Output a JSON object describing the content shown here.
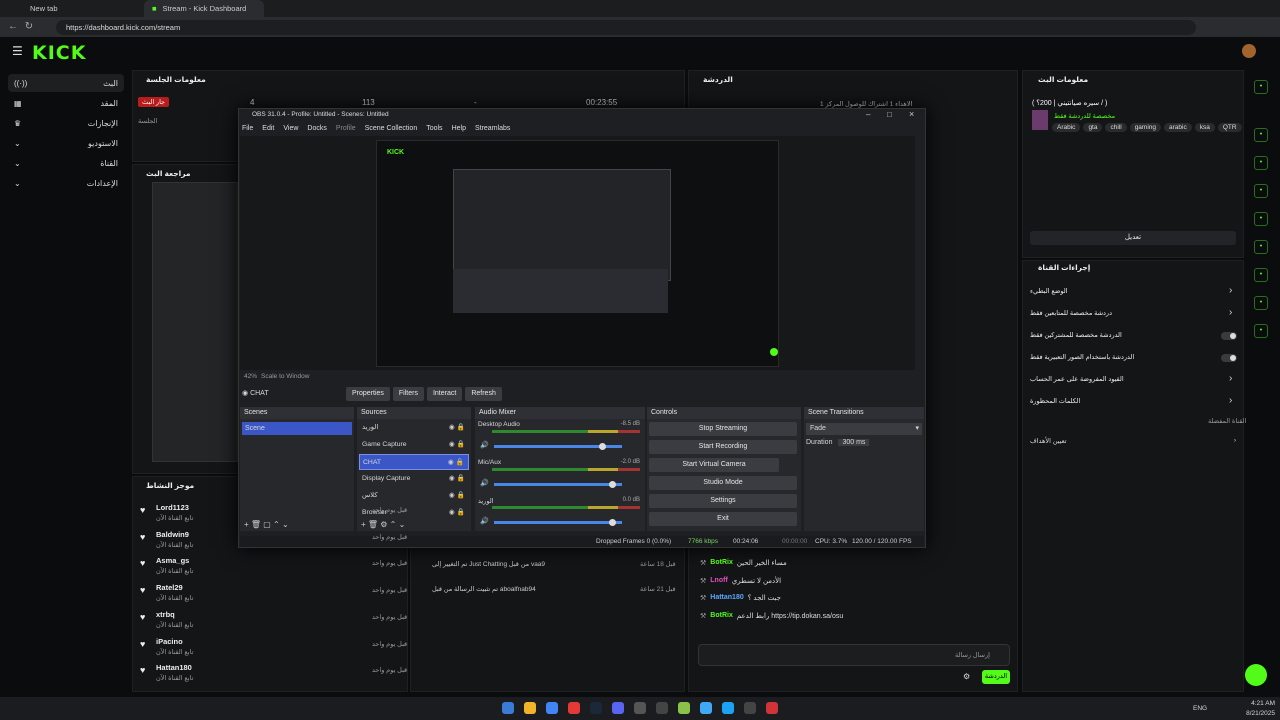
{
  "browser": {
    "tabs": [
      "New tab",
      "Stream - Kick Dashboard"
    ],
    "url": "https://dashboard.kick.com/stream"
  },
  "kick": {
    "logo": "KICK",
    "nav": [
      {
        "label": "البث",
        "icon": "broadcast-icon",
        "active": true
      },
      {
        "label": "المقد",
        "icon": "dashboard-icon"
      },
      {
        "label": "الإنجازات",
        "icon": "trophy-icon"
      },
      {
        "label": "الاستوديو",
        "icon": "studio-icon"
      },
      {
        "label": "القناة",
        "icon": "channel-icon"
      },
      {
        "label": "الإعدادات",
        "icon": "settings-icon"
      }
    ]
  },
  "session": {
    "title": "معلومات الجلسة",
    "live_badge": "جار البث",
    "session_label": "الجلسة",
    "stats": [
      "4",
      "113",
      "-",
      "00:23:55"
    ]
  },
  "preview": {
    "title": "مراجعة البث"
  },
  "activity": {
    "title": "موجز النشاط",
    "items": [
      {
        "name": "Lord1123",
        "sub": "تابع القناة الآن",
        "time": "قبل يوم واحد"
      },
      {
        "name": "Baldwin9",
        "sub": "تابع القناة الآن",
        "time": "قبل يوم واحد"
      },
      {
        "name": "Asma_gs",
        "sub": "تابع القناة الآن",
        "time": "قبل يوم واحد"
      },
      {
        "name": "Ratel29",
        "sub": "تابع القناة الآن",
        "time": "قبل يوم واحد"
      },
      {
        "name": "xtrbq",
        "sub": "تابع القناة الآن",
        "time": "قبل يوم واحد"
      },
      {
        "name": "iPacino",
        "sub": "تابع القناة الآن",
        "time": "قبل يوم واحد"
      },
      {
        "name": "Hattan180",
        "sub": "تابع القناة الآن",
        "time": "قبل يوم واحد"
      }
    ],
    "mid_items": [
      {
        "text": "تم التغيير إلى Just Chatting من قبل vaa9",
        "time": "قبل 18 ساعة"
      },
      {
        "text": "تم تثبيت الرسالة من قبل aboalfnab94",
        "time": "قبل 21 ساعة"
      }
    ]
  },
  "chat": {
    "title": "الدردشة",
    "pinned": "الاهداء 1 اشتراك للوصول المركز 1",
    "messages": [
      {
        "user": "BotRix",
        "text": "مساء الخير الحين"
      },
      {
        "user": "Lnoff",
        "text": "الأدمن لا تسطري"
      },
      {
        "user": "Hattan180",
        "text": "جبت الجد ؟"
      },
      {
        "user": "BotRix",
        "text": "رابط الدعم https://tip.dokan.sa/osu"
      }
    ],
    "input_placeholder": "إرسال رسالة",
    "send_label": "الدردشة"
  },
  "stream_info": {
    "title": "معلومات البث",
    "stream_title": "( سيره صيانتيني | 200؟ / )",
    "category": "مخصصة للدردشة فقط",
    "tags": [
      "Arabic",
      "gta",
      "chill",
      "gaming",
      "arabic",
      "ksa",
      "QTR"
    ],
    "edit_label": "تعديل"
  },
  "channel_actions": {
    "title": "إجراءات القناة",
    "items": [
      {
        "label": "الوضع البطيء",
        "control": "chevron"
      },
      {
        "label": "دردشة مخصصة للمتابعين فقط",
        "control": "chevron"
      },
      {
        "label": "الدردشة مخصصة للمشتركين فقط",
        "control": "toggle"
      },
      {
        "label": "الدردشة باستخدام الصور التعبيرية فقط",
        "control": "toggle"
      },
      {
        "label": "القيود المفروضة على عمر الحساب",
        "control": "chevron"
      },
      {
        "label": "الكلمات المحظورة",
        "control": "chevron"
      }
    ],
    "section": "القناة المفضلة",
    "extra": "تعيين الأهداف"
  },
  "obs": {
    "title": "OBS 31.0.4 - Profile: Untitled - Scenes: Untitled",
    "menu": [
      "File",
      "Edit",
      "View",
      "Docks",
      "Profile",
      "Scene Collection",
      "Tools",
      "Help",
      "Streamlabs"
    ],
    "zoom": "42%",
    "scale_mode": "Scale to Window",
    "source_name": "CHAT",
    "toolbar": [
      "Properties",
      "Filters",
      "Interact",
      "Refresh"
    ],
    "docks": {
      "scenes": {
        "title": "Scenes",
        "items": [
          "Scene"
        ]
      },
      "sources": {
        "title": "Sources",
        "items": [
          "الوريد",
          "Game Capture",
          "CHAT",
          "Display Capture",
          "كلاس",
          "Browser"
        ]
      },
      "mixer": {
        "title": "Audio Mixer",
        "channels": [
          {
            "name": "Desktop Audio",
            "db": "-8.5 dB",
            "level": 0.82
          },
          {
            "name": "Mic/Aux",
            "db": "-2.0 dB",
            "level": 0.9
          },
          {
            "name": "الوريد",
            "db": "0.0 dB",
            "level": 0.9
          }
        ],
        "scale": [
          "-60",
          "-55",
          "-50",
          "-45",
          "-40",
          "-35",
          "-30",
          "-25",
          "-20",
          "-15",
          "-10",
          "-5",
          "0"
        ]
      },
      "controls": {
        "title": "Controls",
        "buttons": [
          "Stop Streaming",
          "Start Recording",
          "Start Virtual Camera",
          "Studio Mode",
          "Settings",
          "Exit"
        ]
      },
      "transitions": {
        "title": "Scene Transitions",
        "type": "Fade",
        "duration_label": "Duration",
        "duration": "300 ms"
      }
    },
    "status": {
      "dropped": "Dropped Frames 0 (0.0%)",
      "kbps": "7766 kbps",
      "rec": "00:00:00",
      "live": "00:24:06",
      "cpu": "CPU: 3.7%",
      "fps": "120.00 / 120.00 FPS"
    }
  },
  "taskbar": {
    "lang": "ENG",
    "time": "4:21 AM",
    "date": "8/21/2025"
  },
  "colors": {
    "accent": "#53fc18",
    "bg": "#0b0c0d",
    "panel": "#141517"
  }
}
